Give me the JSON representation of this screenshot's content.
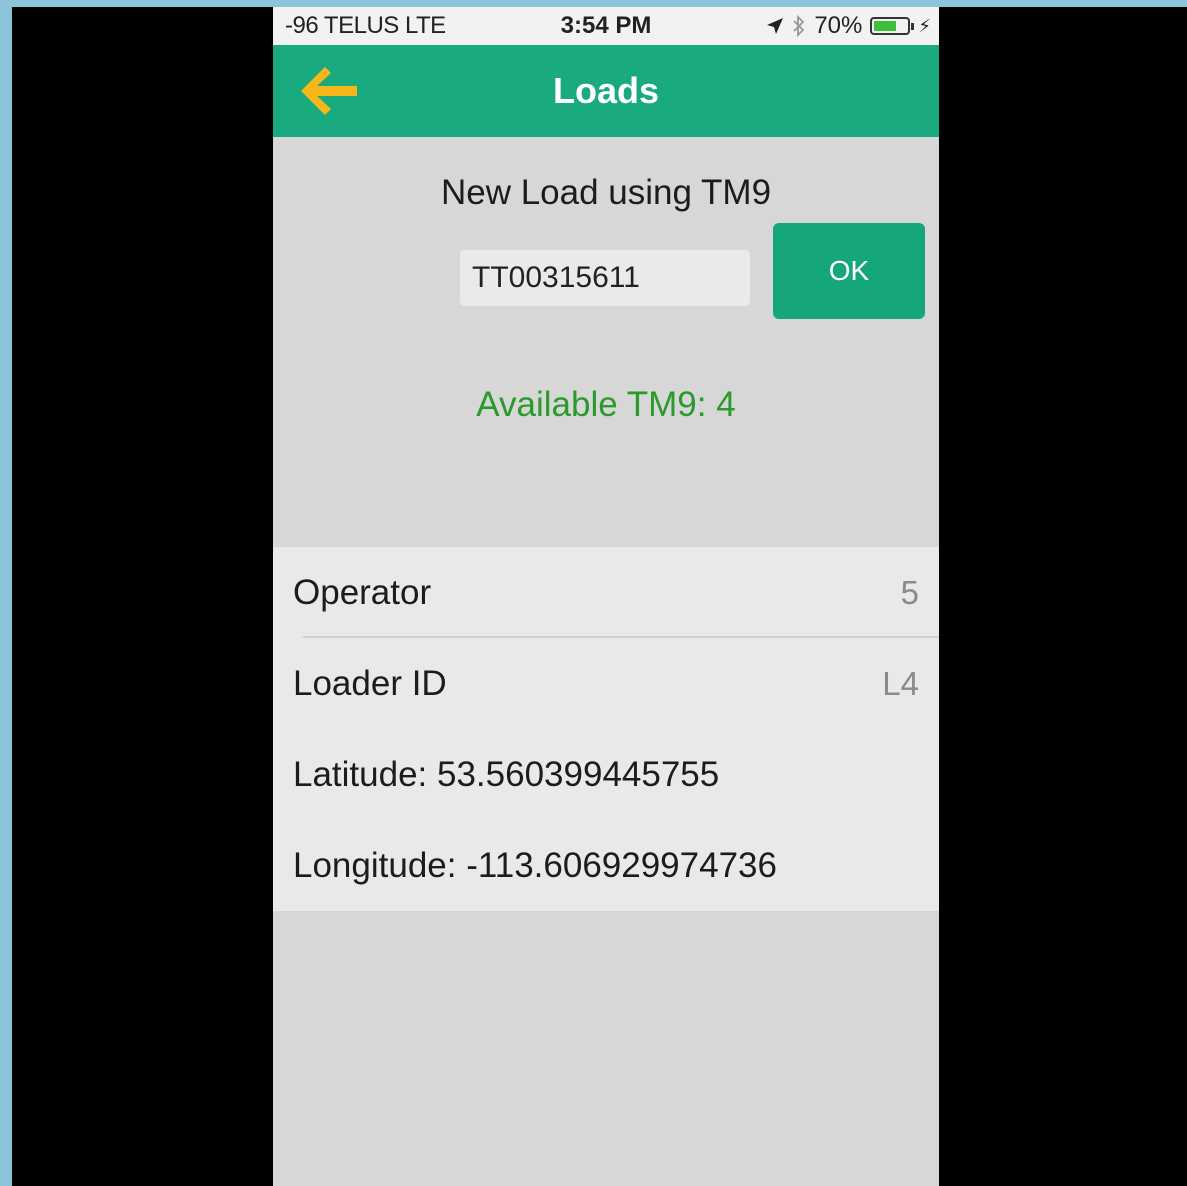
{
  "status_bar": {
    "carrier": "-96 TELUS  LTE",
    "time": "3:54 PM",
    "battery_percent": "70%",
    "battery_level": 0.7,
    "icons": [
      "location-arrow-icon",
      "bluetooth-icon",
      "battery-icon",
      "charging-bolt-icon"
    ]
  },
  "nav": {
    "title": "Loads",
    "back_icon": "back-arrow-icon",
    "back_color": "#f7b718",
    "bar_color": "#19ab7f"
  },
  "form": {
    "heading": "New Load using TM9",
    "input_value": "TT00315611",
    "ok_label": "OK",
    "available_text": "Available TM9: 4",
    "available_color": "#2a9a2a"
  },
  "details": {
    "operator_label": "Operator",
    "operator_value": "5",
    "loader_label": "Loader ID",
    "loader_value": "L4",
    "latitude_text": "Latitude: 53.560399445755",
    "longitude_text": "Longitude: -113.606929974736"
  }
}
